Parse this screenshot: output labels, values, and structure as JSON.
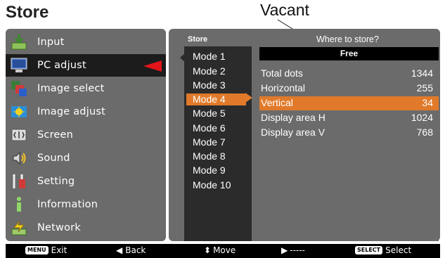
{
  "page_title": "Store",
  "annotation": "Vacant",
  "menu": {
    "items": [
      {
        "label": "Input",
        "icon": "input-icon"
      },
      {
        "label": "PC adjust",
        "icon": "pc-adjust-icon"
      },
      {
        "label": "Image select",
        "icon": "image-select-icon"
      },
      {
        "label": "Image adjust",
        "icon": "image-adjust-icon"
      },
      {
        "label": "Screen",
        "icon": "screen-icon"
      },
      {
        "label": "Sound",
        "icon": "sound-icon"
      },
      {
        "label": "Setting",
        "icon": "setting-icon"
      },
      {
        "label": "Information",
        "icon": "information-icon"
      },
      {
        "label": "Network",
        "icon": "network-icon"
      }
    ],
    "active_index": 1
  },
  "panel": {
    "store_label": "Store",
    "where_label": "Where to store?",
    "modes": [
      "Mode 1",
      "Mode 2",
      "Mode 3",
      "Mode 4",
      "Mode 5",
      "Mode 6",
      "Mode 7",
      "Mode 8",
      "Mode 9",
      "Mode 10"
    ],
    "selected_mode": "Mode 4",
    "free_label": "Free",
    "info": [
      {
        "label": "Total dots",
        "value": "1344"
      },
      {
        "label": "Horizontal",
        "value": "255"
      },
      {
        "label": "Vertical",
        "value": "34"
      },
      {
        "label": "Display area H",
        "value": "1024"
      },
      {
        "label": "Display area V",
        "value": "768"
      }
    ],
    "highlighted_info_row": "Vertical"
  },
  "bottom_bar": {
    "menu_key": "MENU",
    "exit": "Exit",
    "back": "Back",
    "move": "Move",
    "dashes": "-----",
    "select_key": "SELECT",
    "select": "Select"
  },
  "colors": {
    "panel_bg": "#6b6b6b",
    "highlight": "#e07a2a",
    "active_arrow": "#e3141a",
    "mode_list_bg": "#2b2b2b"
  }
}
